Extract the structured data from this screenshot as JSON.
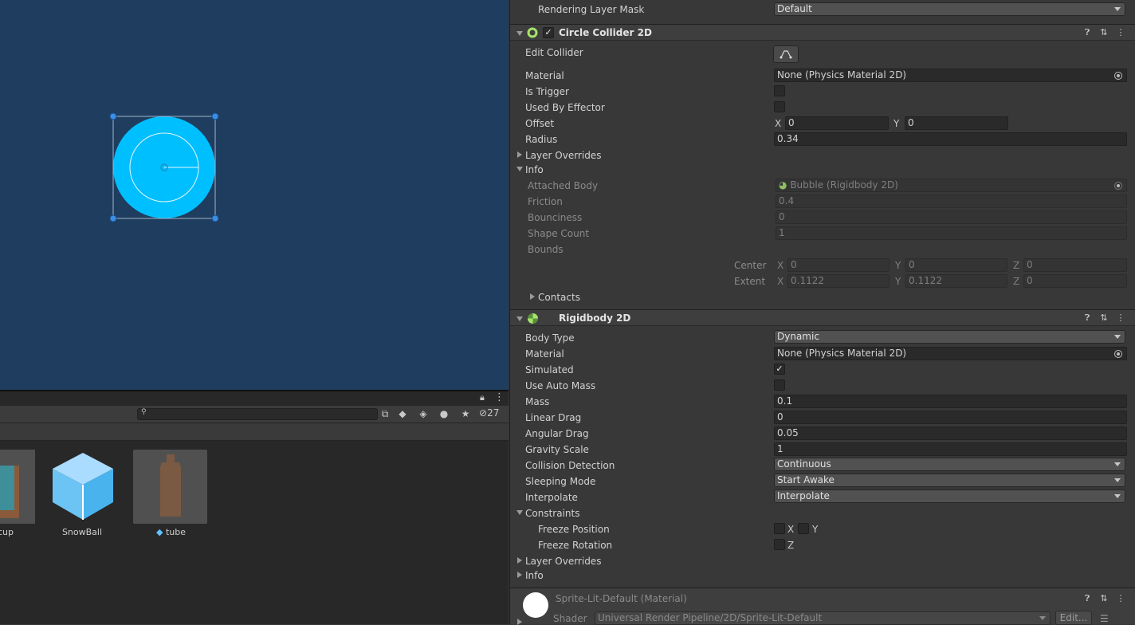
{
  "project": {
    "hidden_count": "27",
    "assets": [
      {
        "name": "cup"
      },
      {
        "name": "SnowBall"
      },
      {
        "name": "tube"
      }
    ]
  },
  "inspector": {
    "rendering_layer_mask": {
      "label": "Rendering Layer Mask",
      "value": "Default"
    },
    "circle_collider": {
      "title": "Circle Collider 2D",
      "edit_collider_label": "Edit Collider",
      "material_label": "Material",
      "material_value": "None (Physics Material 2D)",
      "is_trigger_label": "Is Trigger",
      "used_by_effector_label": "Used By Effector",
      "offset_label": "Offset",
      "offset_x": "0",
      "offset_y": "0",
      "radius_label": "Radius",
      "radius_value": "0.34",
      "layer_overrides_label": "Layer Overrides",
      "info": {
        "label": "Info",
        "attached_body_label": "Attached Body",
        "attached_body_value": "Bubble (Rigidbody 2D)",
        "friction_label": "Friction",
        "friction_value": "0.4",
        "bounciness_label": "Bounciness",
        "bounciness_value": "0",
        "shape_count_label": "Shape Count",
        "shape_count_value": "1",
        "bounds_label": "Bounds",
        "center_label": "Center",
        "center_x": "0",
        "center_y": "0",
        "center_z": "0",
        "extent_label": "Extent",
        "extent_x": "0.1122",
        "extent_y": "0.1122",
        "extent_z": "0",
        "contacts_label": "Contacts"
      }
    },
    "rigidbody": {
      "title": "Rigidbody 2D",
      "body_type_label": "Body Type",
      "body_type_value": "Dynamic",
      "material_label": "Material",
      "material_value": "None (Physics Material 2D)",
      "simulated_label": "Simulated",
      "use_auto_mass_label": "Use Auto Mass",
      "mass_label": "Mass",
      "mass_value": "0.1",
      "linear_drag_label": "Linear Drag",
      "linear_drag_value": "0",
      "angular_drag_label": "Angular Drag",
      "angular_drag_value": "0.05",
      "gravity_scale_label": "Gravity Scale",
      "gravity_scale_value": "1",
      "collision_detection_label": "Collision Detection",
      "collision_detection_value": "Continuous",
      "sleeping_mode_label": "Sleeping Mode",
      "sleeping_mode_value": "Start Awake",
      "interpolate_label": "Interpolate",
      "interpolate_value": "Interpolate",
      "constraints_label": "Constraints",
      "freeze_position_label": "Freeze Position",
      "freeze_rotation_label": "Freeze Rotation",
      "layer_overrides_label": "Layer Overrides",
      "info_label": "Info"
    },
    "material": {
      "title": "Sprite-Lit-Default (Material)",
      "shader_label": "Shader",
      "shader_value": "Universal Render Pipeline/2D/Sprite-Lit-Default",
      "edit_label": "Edit..."
    },
    "axes": {
      "x": "X",
      "y": "Y",
      "z": "Z"
    }
  },
  "colors": {
    "scene_bg": "#1f3d5e",
    "bubble": "#00bfff",
    "accent_green": "#a6e36a"
  }
}
